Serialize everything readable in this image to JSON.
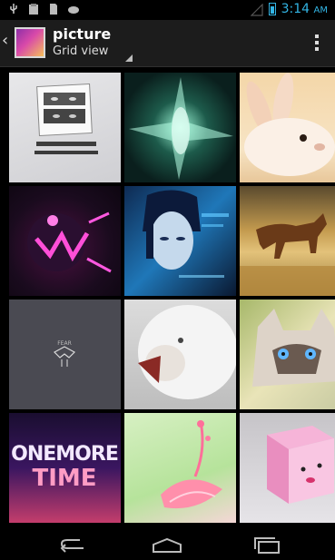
{
  "status": {
    "time": "3:14",
    "ampm": "AM",
    "accent": "#33b5e5"
  },
  "actionbar": {
    "title": "picture",
    "subtitle": "Grid view",
    "icons": [
      "up-arrow-icon",
      "album-thumbnail",
      "overflow-menu-icon"
    ]
  },
  "grid": {
    "items": [
      {
        "name": "photo-collage-faces",
        "text": "One sentence for the coming out of ourselves.\n不要让生活太累，让心灵放个假"
      },
      {
        "name": "photo-green-abstract-sparkle"
      },
      {
        "name": "photo-white-rabbit"
      },
      {
        "name": "photo-purple-neon-sphere"
      },
      {
        "name": "photo-cyber-girl"
      },
      {
        "name": "photo-running-horse"
      },
      {
        "name": "photo-dark-gray-minimal",
        "text": "FEAR"
      },
      {
        "name": "photo-white-lion"
      },
      {
        "name": "photo-blue-eyed-cat"
      },
      {
        "name": "photo-one-more-time-typography",
        "text": "ONEMORE TIME"
      },
      {
        "name": "photo-pink-flower"
      },
      {
        "name": "photo-pink-toy-cube"
      }
    ]
  },
  "navbar": {
    "icons": [
      "back-icon",
      "home-icon",
      "recent-apps-icon"
    ]
  }
}
